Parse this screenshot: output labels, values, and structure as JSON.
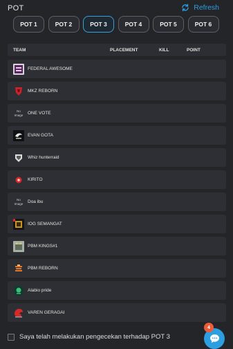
{
  "header": {
    "title": "POT",
    "refresh_label": "Refresh"
  },
  "tabs": [
    {
      "label": "POT 1"
    },
    {
      "label": "POT 2"
    },
    {
      "label": "POT 3",
      "active": true
    },
    {
      "label": "POT 4"
    },
    {
      "label": "POT 5"
    },
    {
      "label": "POT 6"
    }
  ],
  "table": {
    "columns": {
      "team": "TEAM",
      "placement": "PLACEMENT",
      "kill": "KILL",
      "point": "POINT"
    },
    "rows": [
      {
        "name": "FEDERAL AWESOME",
        "logo": "federal-awesome-logo"
      },
      {
        "name": "MKZ REBORN",
        "logo": "mkz-reborn-logo"
      },
      {
        "name": "ONE VOTE",
        "logo": "no-image",
        "no_image_text": "No Image"
      },
      {
        "name": "EVAN GOTA",
        "logo": "evan-gota-logo"
      },
      {
        "name": "Whiz hunterraid",
        "logo": "whiz-hunterraid-logo"
      },
      {
        "name": "KIRITO",
        "logo": "kirito-logo"
      },
      {
        "name": "Doa ibu",
        "logo": "no-image",
        "no_image_text": "No Image"
      },
      {
        "name": "IOG SEMANGAT",
        "logo": "iog-semangat-logo"
      },
      {
        "name": "PBM KINGS#1",
        "logo": "pbm-kings-logo"
      },
      {
        "name": "PBM REBORN",
        "logo": "pbm-reborn-logo"
      },
      {
        "name": "Alabio pride",
        "logo": "alabio-pride-logo"
      },
      {
        "name": "VAREN GERAGAI",
        "logo": "varen-geragai-logo"
      }
    ]
  },
  "footer": {
    "confirm_text": "Saya telah melakukan pengecekan terhadap POT 3"
  },
  "chat": {
    "badge_count": "4"
  },
  "colors": {
    "accent": "#2f9ee0",
    "badge": "#ec5b3a",
    "background": "#232529",
    "row": "#2d2f34"
  }
}
